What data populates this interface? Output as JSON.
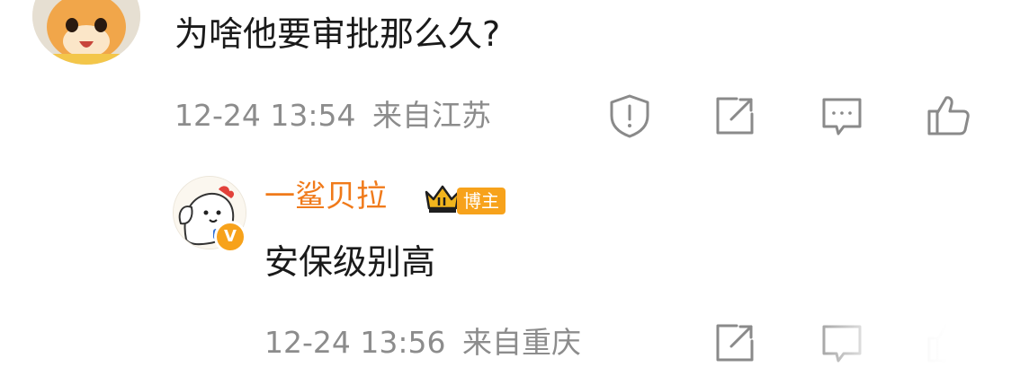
{
  "comment": {
    "avatar_icon": "cat-avatar",
    "text": "为啥他要审批那么久?",
    "timestamp": "12-24 13:54",
    "location": "来自江苏",
    "actions": [
      "report-icon",
      "share-icon",
      "reply-icon",
      "like-icon"
    ]
  },
  "reply": {
    "avatar_icon": "cartoon-avatar",
    "verified_mark": "V",
    "username": "一鲨贝拉",
    "level_icon": "crown-icon",
    "badge": "博主",
    "text": "安保级别高",
    "timestamp": "12-24 13:56",
    "location": "来自重庆",
    "actions": [
      "share-icon",
      "reply-icon",
      "like-icon"
    ]
  },
  "colors": {
    "username": "#f07a1a",
    "badge": "#f7a21b",
    "meta": "#8c8c8c",
    "icon": "#8a8a8a"
  }
}
